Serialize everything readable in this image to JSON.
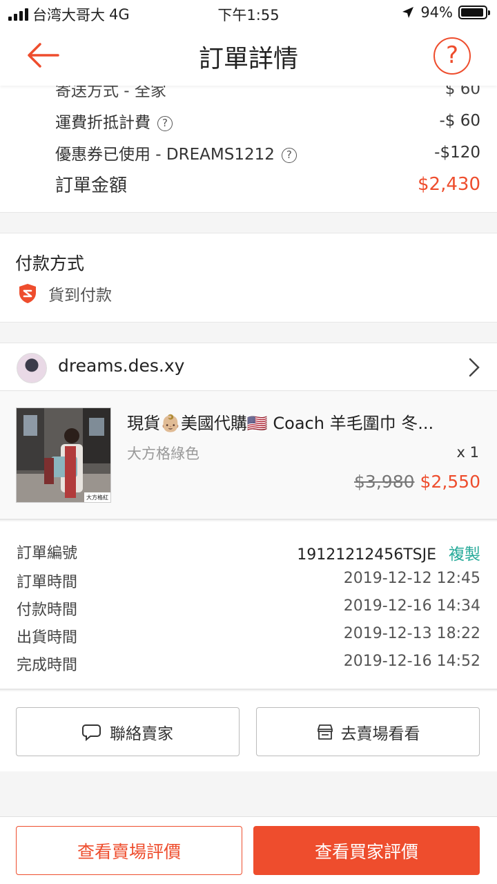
{
  "status_bar": {
    "carrier": "台湾大哥大",
    "network": "4G",
    "time": "下午1:55",
    "battery": "94%",
    "battery_level": 0.94
  },
  "header": {
    "title": "訂單詳情",
    "help_symbol": "?"
  },
  "summary": {
    "clipped_label": "寄送方式 - 全家",
    "clipped_value": "$ 60",
    "shipping_discount_label": "運費折抵計費",
    "shipping_discount_value": "-$ 60",
    "coupon_label": "優惠券已使用 - DREAMS1212",
    "coupon_value": "-$120",
    "total_label": "訂單金額",
    "total_value": "$2,430"
  },
  "payment": {
    "title": "付款方式",
    "method": "貨到付款"
  },
  "shop": {
    "name": "dreams.des.xy"
  },
  "product": {
    "name": "現貨👶🏼美國代購🇺🇸 Coach 羊毛圍巾 冬...",
    "variation": "大方格綠色",
    "quantity": "x 1",
    "original_price": "$3,980",
    "price": "$2,550",
    "thumb_caption": "大方格紅"
  },
  "order_info": {
    "order_no_label": "訂單編號",
    "order_no": "19121212456TSJE",
    "copy_label": "複製",
    "rows": [
      {
        "label": "訂單時間",
        "value": "2019-12-12 12:45"
      },
      {
        "label": "付款時間",
        "value": "2019-12-16 14:34"
      },
      {
        "label": "出貨時間",
        "value": "2019-12-13 18:22"
      },
      {
        "label": "完成時間",
        "value": "2019-12-16 14:52"
      }
    ]
  },
  "actions": {
    "contact_seller": "聯絡賣家",
    "visit_shop": "去賣場看看"
  },
  "bottom_bar": {
    "view_shop_rating": "查看賣場評價",
    "view_buyer_rating": "查看買家評價"
  },
  "colors": {
    "accent": "#ee4d2d",
    "copy": "#26aa99"
  }
}
